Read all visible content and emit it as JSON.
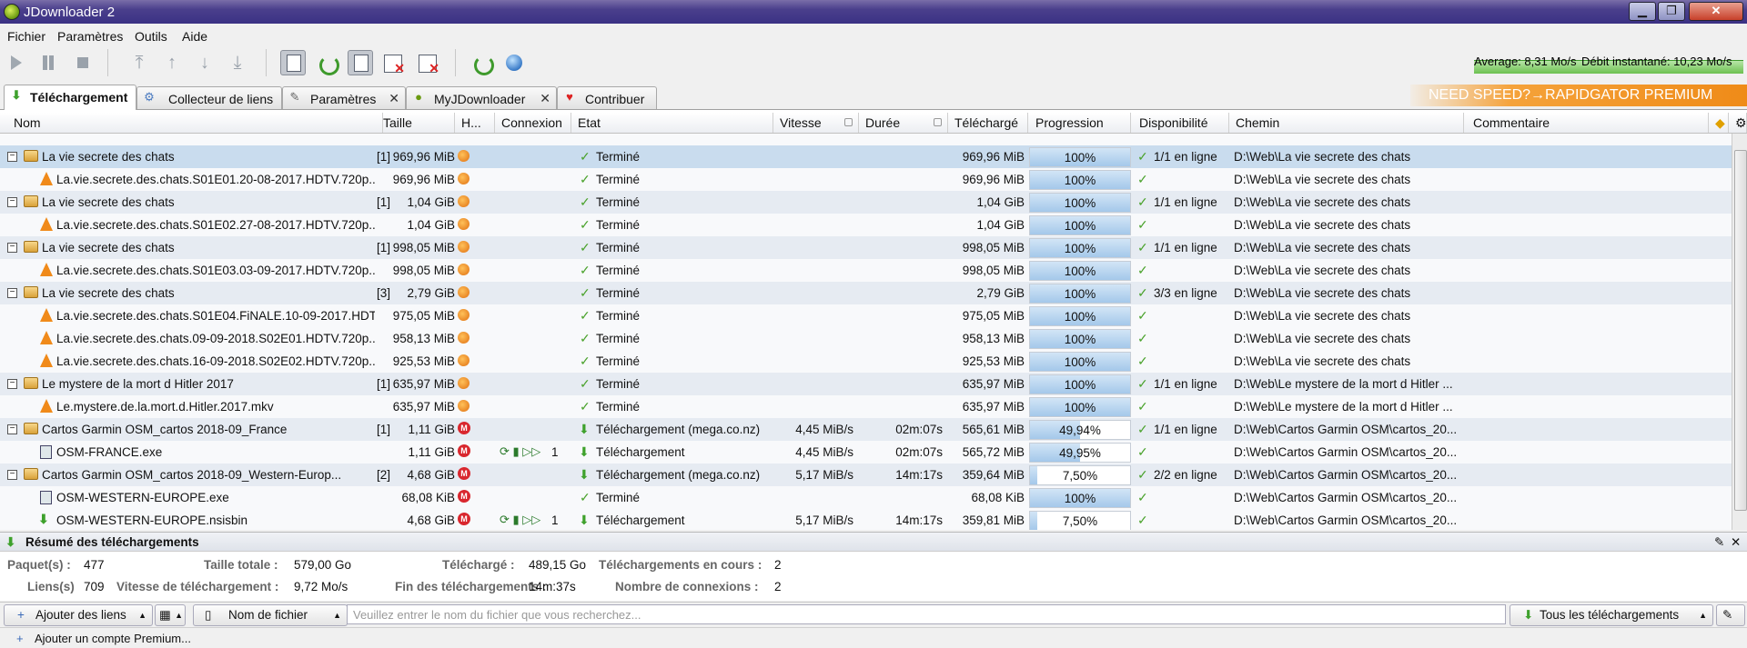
{
  "window": {
    "title": "JDownloader 2",
    "minimize": "▁",
    "maximize": "❐",
    "close": "✕"
  },
  "menu": [
    "Fichier",
    "Paramètres",
    "Outils",
    "Aide"
  ],
  "speed": {
    "average": "Average: 8,31 Mo/s",
    "instant": "Débit instantané: 10,23 Mo/s"
  },
  "tabs": [
    {
      "label": "Téléchargement",
      "closable": false
    },
    {
      "label": "Collecteur de liens",
      "closable": false
    },
    {
      "label": "Paramètres",
      "closable": true
    },
    {
      "label": "MyJDownloader",
      "closable": true
    },
    {
      "label": "Contribuer",
      "closable": false
    }
  ],
  "promo": "NEED SPEED?→RAPIDGATOR PREMIUM",
  "columns": [
    "Nom",
    "Taille",
    "H...",
    "Connexion",
    "Etat",
    "Vitesse",
    "Durée",
    "Téléchargé",
    "Progression",
    "Disponibilité",
    "Chemin",
    "Commentaire"
  ],
  "rows": [
    {
      "type": "pkg",
      "sel": true,
      "name": "La vie secrete des chats",
      "count": "[1]",
      "size": "969,96 MiB",
      "host": "orange",
      "conn": "",
      "state": "Terminé",
      "stateIcon": "check",
      "speed": "",
      "duration": "",
      "downloaded": "969,96 MiB",
      "progress": "100%",
      "pct": 1.0,
      "avail": "1/1 en ligne",
      "path": "D:\\Web\\La vie secrete des chats"
    },
    {
      "type": "link",
      "icon": "vlc",
      "name": "La.vie.secrete.des.chats.S01E01.20-08-2017.HDTV.720p...",
      "count": "",
      "size": "969,96 MiB",
      "host": "orange",
      "conn": "",
      "state": "Terminé",
      "stateIcon": "check",
      "speed": "",
      "duration": "",
      "downloaded": "969,96 MiB",
      "progress": "100%",
      "pct": 1.0,
      "avail": "",
      "path": "D:\\Web\\La vie secrete des chats"
    },
    {
      "type": "pkg",
      "name": "La vie secrete des chats",
      "count": "[1]",
      "size": "1,04 GiB",
      "host": "orange",
      "conn": "",
      "state": "Terminé",
      "stateIcon": "check",
      "speed": "",
      "duration": "",
      "downloaded": "1,04 GiB",
      "progress": "100%",
      "pct": 1.0,
      "avail": "1/1 en ligne",
      "path": "D:\\Web\\La vie secrete des chats"
    },
    {
      "type": "link",
      "icon": "vlc",
      "name": "La.vie.secrete.des.chats.S01E02.27-08-2017.HDTV.720p...",
      "count": "",
      "size": "1,04 GiB",
      "host": "orange",
      "conn": "",
      "state": "Terminé",
      "stateIcon": "check",
      "speed": "",
      "duration": "",
      "downloaded": "1,04 GiB",
      "progress": "100%",
      "pct": 1.0,
      "avail": "",
      "path": "D:\\Web\\La vie secrete des chats"
    },
    {
      "type": "pkg",
      "name": "La vie secrete des chats",
      "count": "[1]",
      "size": "998,05 MiB",
      "host": "orange",
      "conn": "",
      "state": "Terminé",
      "stateIcon": "check",
      "speed": "",
      "duration": "",
      "downloaded": "998,05 MiB",
      "progress": "100%",
      "pct": 1.0,
      "avail": "1/1 en ligne",
      "path": "D:\\Web\\La vie secrete des chats"
    },
    {
      "type": "link",
      "icon": "vlc",
      "name": "La.vie.secrete.des.chats.S01E03.03-09-2017.HDTV.720p...",
      "count": "",
      "size": "998,05 MiB",
      "host": "orange",
      "conn": "",
      "state": "Terminé",
      "stateIcon": "check",
      "speed": "",
      "duration": "",
      "downloaded": "998,05 MiB",
      "progress": "100%",
      "pct": 1.0,
      "avail": "",
      "path": "D:\\Web\\La vie secrete des chats"
    },
    {
      "type": "pkg",
      "name": "La vie secrete des chats",
      "count": "[3]",
      "size": "2,79 GiB",
      "host": "orange",
      "conn": "",
      "state": "Terminé",
      "stateIcon": "check",
      "speed": "",
      "duration": "",
      "downloaded": "2,79 GiB",
      "progress": "100%",
      "pct": 1.0,
      "avail": "3/3 en ligne",
      "path": "D:\\Web\\La vie secrete des chats"
    },
    {
      "type": "link",
      "icon": "vlc",
      "name": "La.vie.secrete.des.chats.S01E04.FiNALE.10-09-2017.HDT...",
      "count": "",
      "size": "975,05 MiB",
      "host": "orange",
      "conn": "",
      "state": "Terminé",
      "stateIcon": "check",
      "speed": "",
      "duration": "",
      "downloaded": "975,05 MiB",
      "progress": "100%",
      "pct": 1.0,
      "avail": "",
      "path": "D:\\Web\\La vie secrete des chats"
    },
    {
      "type": "link",
      "icon": "vlc",
      "name": "La.vie.secrete.des.chats.09-09-2018.S02E01.HDTV.720p...",
      "count": "",
      "size": "958,13 MiB",
      "host": "orange",
      "conn": "",
      "state": "Terminé",
      "stateIcon": "check",
      "speed": "",
      "duration": "",
      "downloaded": "958,13 MiB",
      "progress": "100%",
      "pct": 1.0,
      "avail": "",
      "path": "D:\\Web\\La vie secrete des chats"
    },
    {
      "type": "link",
      "icon": "vlc",
      "name": "La.vie.secrete.des.chats.16-09-2018.S02E02.HDTV.720p...",
      "count": "",
      "size": "925,53 MiB",
      "host": "orange",
      "conn": "",
      "state": "Terminé",
      "stateIcon": "check",
      "speed": "",
      "duration": "",
      "downloaded": "925,53 MiB",
      "progress": "100%",
      "pct": 1.0,
      "avail": "",
      "path": "D:\\Web\\La vie secrete des chats"
    },
    {
      "type": "pkg",
      "name": "Le mystere de la mort d Hitler 2017",
      "count": "[1]",
      "size": "635,97 MiB",
      "host": "orange",
      "conn": "",
      "state": "Terminé",
      "stateIcon": "check",
      "speed": "",
      "duration": "",
      "downloaded": "635,97 MiB",
      "progress": "100%",
      "pct": 1.0,
      "avail": "1/1 en ligne",
      "path": "D:\\Web\\Le mystere de la mort d Hitler ..."
    },
    {
      "type": "link",
      "icon": "vlc",
      "name": "Le.mystere.de.la.mort.d.Hitler.2017.mkv",
      "count": "",
      "size": "635,97 MiB",
      "host": "orange",
      "conn": "",
      "state": "Terminé",
      "stateIcon": "check",
      "speed": "",
      "duration": "",
      "downloaded": "635,97 MiB",
      "progress": "100%",
      "pct": 1.0,
      "avail": "",
      "path": "D:\\Web\\Le mystere de la mort d Hitler ..."
    },
    {
      "type": "pkg",
      "name": "Cartos Garmin OSM_cartos 2018-09_France",
      "count": "[1]",
      "size": "1,11 GiB",
      "host": "mega",
      "conn": "",
      "state": "Téléchargement (mega.co.nz)",
      "stateIcon": "dl",
      "speed": "4,45 MiB/s",
      "duration": "02m:07s",
      "downloaded": "565,61 MiB",
      "progress": "49,94%",
      "pct": 0.4994,
      "avail": "1/1 en ligne",
      "path": "D:\\Web\\Cartos Garmin OSM\\cartos_20..."
    },
    {
      "type": "link",
      "icon": "exe",
      "name": "OSM-FRANCE.exe",
      "count": "",
      "size": "1,11 GiB",
      "host": "mega",
      "conn": "1",
      "state": "Téléchargement",
      "stateIcon": "dl",
      "speed": "4,45 MiB/s",
      "duration": "02m:07s",
      "downloaded": "565,72 MiB",
      "progress": "49,95%",
      "pct": 0.4995,
      "avail": "",
      "path": "D:\\Web\\Cartos Garmin OSM\\cartos_20..."
    },
    {
      "type": "pkg",
      "name": "Cartos Garmin OSM_cartos 2018-09_Western-Europ...",
      "count": "[2]",
      "size": "4,68 GiB",
      "host": "mega",
      "conn": "",
      "state": "Téléchargement (mega.co.nz)",
      "stateIcon": "dl",
      "speed": "5,17 MiB/s",
      "duration": "14m:17s",
      "downloaded": "359,64 MiB",
      "progress": "7,50%",
      "pct": 0.075,
      "avail": "2/2 en ligne",
      "path": "D:\\Web\\Cartos Garmin OSM\\cartos_20..."
    },
    {
      "type": "link",
      "icon": "exe",
      "name": "OSM-WESTERN-EUROPE.exe",
      "count": "",
      "size": "68,08 KiB",
      "host": "mega",
      "conn": "",
      "state": "Terminé",
      "stateIcon": "check",
      "speed": "",
      "duration": "",
      "downloaded": "68,08 KiB",
      "progress": "100%",
      "pct": 1.0,
      "avail": "",
      "path": "D:\\Web\\Cartos Garmin OSM\\cartos_20..."
    },
    {
      "type": "link",
      "icon": "dl",
      "name": "OSM-WESTERN-EUROPE.nsisbin",
      "count": "",
      "size": "4,68 GiB",
      "host": "mega",
      "conn": "1",
      "state": "Téléchargement",
      "stateIcon": "dl",
      "speed": "5,17 MiB/s",
      "duration": "14m:17s",
      "downloaded": "359,81 MiB",
      "progress": "7,50%",
      "pct": 0.075,
      "avail": "",
      "path": "D:\\Web\\Cartos Garmin OSM\\cartos_20..."
    }
  ],
  "summary": {
    "title": "Résumé des téléchargements",
    "packages_label": "Paquet(s) :",
    "packages": "477",
    "total_label": "Taille totale :",
    "total": "579,00 Go",
    "downloaded_label": "Téléchargé :",
    "downloaded": "489,15 Go",
    "running_label": "Téléchargements en cours :",
    "running": "2",
    "links_label": "Liens(s)",
    "links": "709",
    "speed_label": "Vitesse de téléchargement :",
    "speed": "9,72 Mo/s",
    "eta_label": "Fin des téléchargements :",
    "eta": "14m:37s",
    "connections_label": "Nombre de connexions :",
    "connections": "2"
  },
  "bottom": {
    "add_links": "Ajouter des liens",
    "filename": "Nom de fichier",
    "search_placeholder": "Veuillez entrer le nom du fichier que vous recherchez...",
    "all_downloads": "Tous les téléchargements"
  },
  "status": {
    "add_premium": "Ajouter un compte Premium..."
  }
}
